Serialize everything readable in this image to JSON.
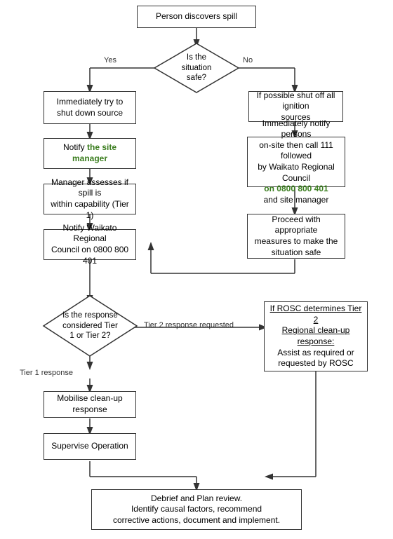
{
  "boxes": {
    "person_discovers": {
      "text": "Person discovers spill"
    },
    "is_situation_safe": {
      "text": "Is the\nsituation\nsafe?"
    },
    "shut_down_source": {
      "text": "Immediately try to\nshut down source"
    },
    "notify_site_manager": {
      "text": "Notify ",
      "green": "the site manager"
    },
    "manager_assesses": {
      "text": "Manager assesses if spill is\nwithin capability (Tier 1)"
    },
    "notify_waikato": {
      "text": "Notify Waikato Regional\nCouncil on 0800 800 401"
    },
    "is_tier": {
      "text": "Is the response\nconsidered Tier\n1 or Tier 2?"
    },
    "tier1_label": {
      "text": "Tier 1 response"
    },
    "mobilise": {
      "text": "Mobilise clean-up response"
    },
    "supervise": {
      "text": "Supervise Operation"
    },
    "debrief": {
      "text": "Debrief and Plan review.\nIdentify causal factors, recommend\ncorrective actions, document and implement."
    },
    "ignition": {
      "text": "If possible shut off all ignition\nsources"
    },
    "notify_persons": {
      "text": "Immediately notify persons\non-site then call 111 followed\nby Waikato Regional Council\n",
      "green": "on 0800 800 401",
      "text2": "\nand site manager"
    },
    "proceed_measures": {
      "text": "Proceed with appropriate\nmeasures to make the\nsituation safe"
    },
    "rosc": {
      "text": "If ROSC determines Tier 2\nRegional clean-up response:\nAssist as required or\nrequested by ROSC"
    },
    "tier2_label": {
      "text": "Tier 2 response requested"
    },
    "yes_label": {
      "text": "Yes"
    },
    "no_label": {
      "text": "No"
    }
  }
}
